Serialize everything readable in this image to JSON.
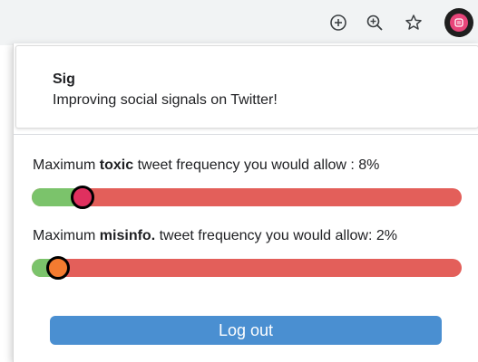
{
  "browser": {
    "icons": [
      "add-circle-icon",
      "zoom-in-icon",
      "star-icon",
      "sig-extension-icon"
    ]
  },
  "popup": {
    "app_name": "Sig",
    "tagline": "Improving social signals on Twitter!",
    "sliders": [
      {
        "prefix": "Maximum",
        "keyword": "toxic",
        "suffix": "tweet frequency you would allow : 8%",
        "value_percent": 8,
        "thumb_color": "#e0305f"
      },
      {
        "prefix": "Maximum",
        "keyword": "misinfo.",
        "suffix": "tweet frequency you would allow: 2%",
        "value_percent": 2,
        "thumb_color": "#f47b30"
      }
    ],
    "logout_label": "Log out"
  },
  "colors": {
    "track_allowed": "#7bc36b",
    "track_disallowed": "#e35f5a",
    "button": "#4a8fd1"
  }
}
